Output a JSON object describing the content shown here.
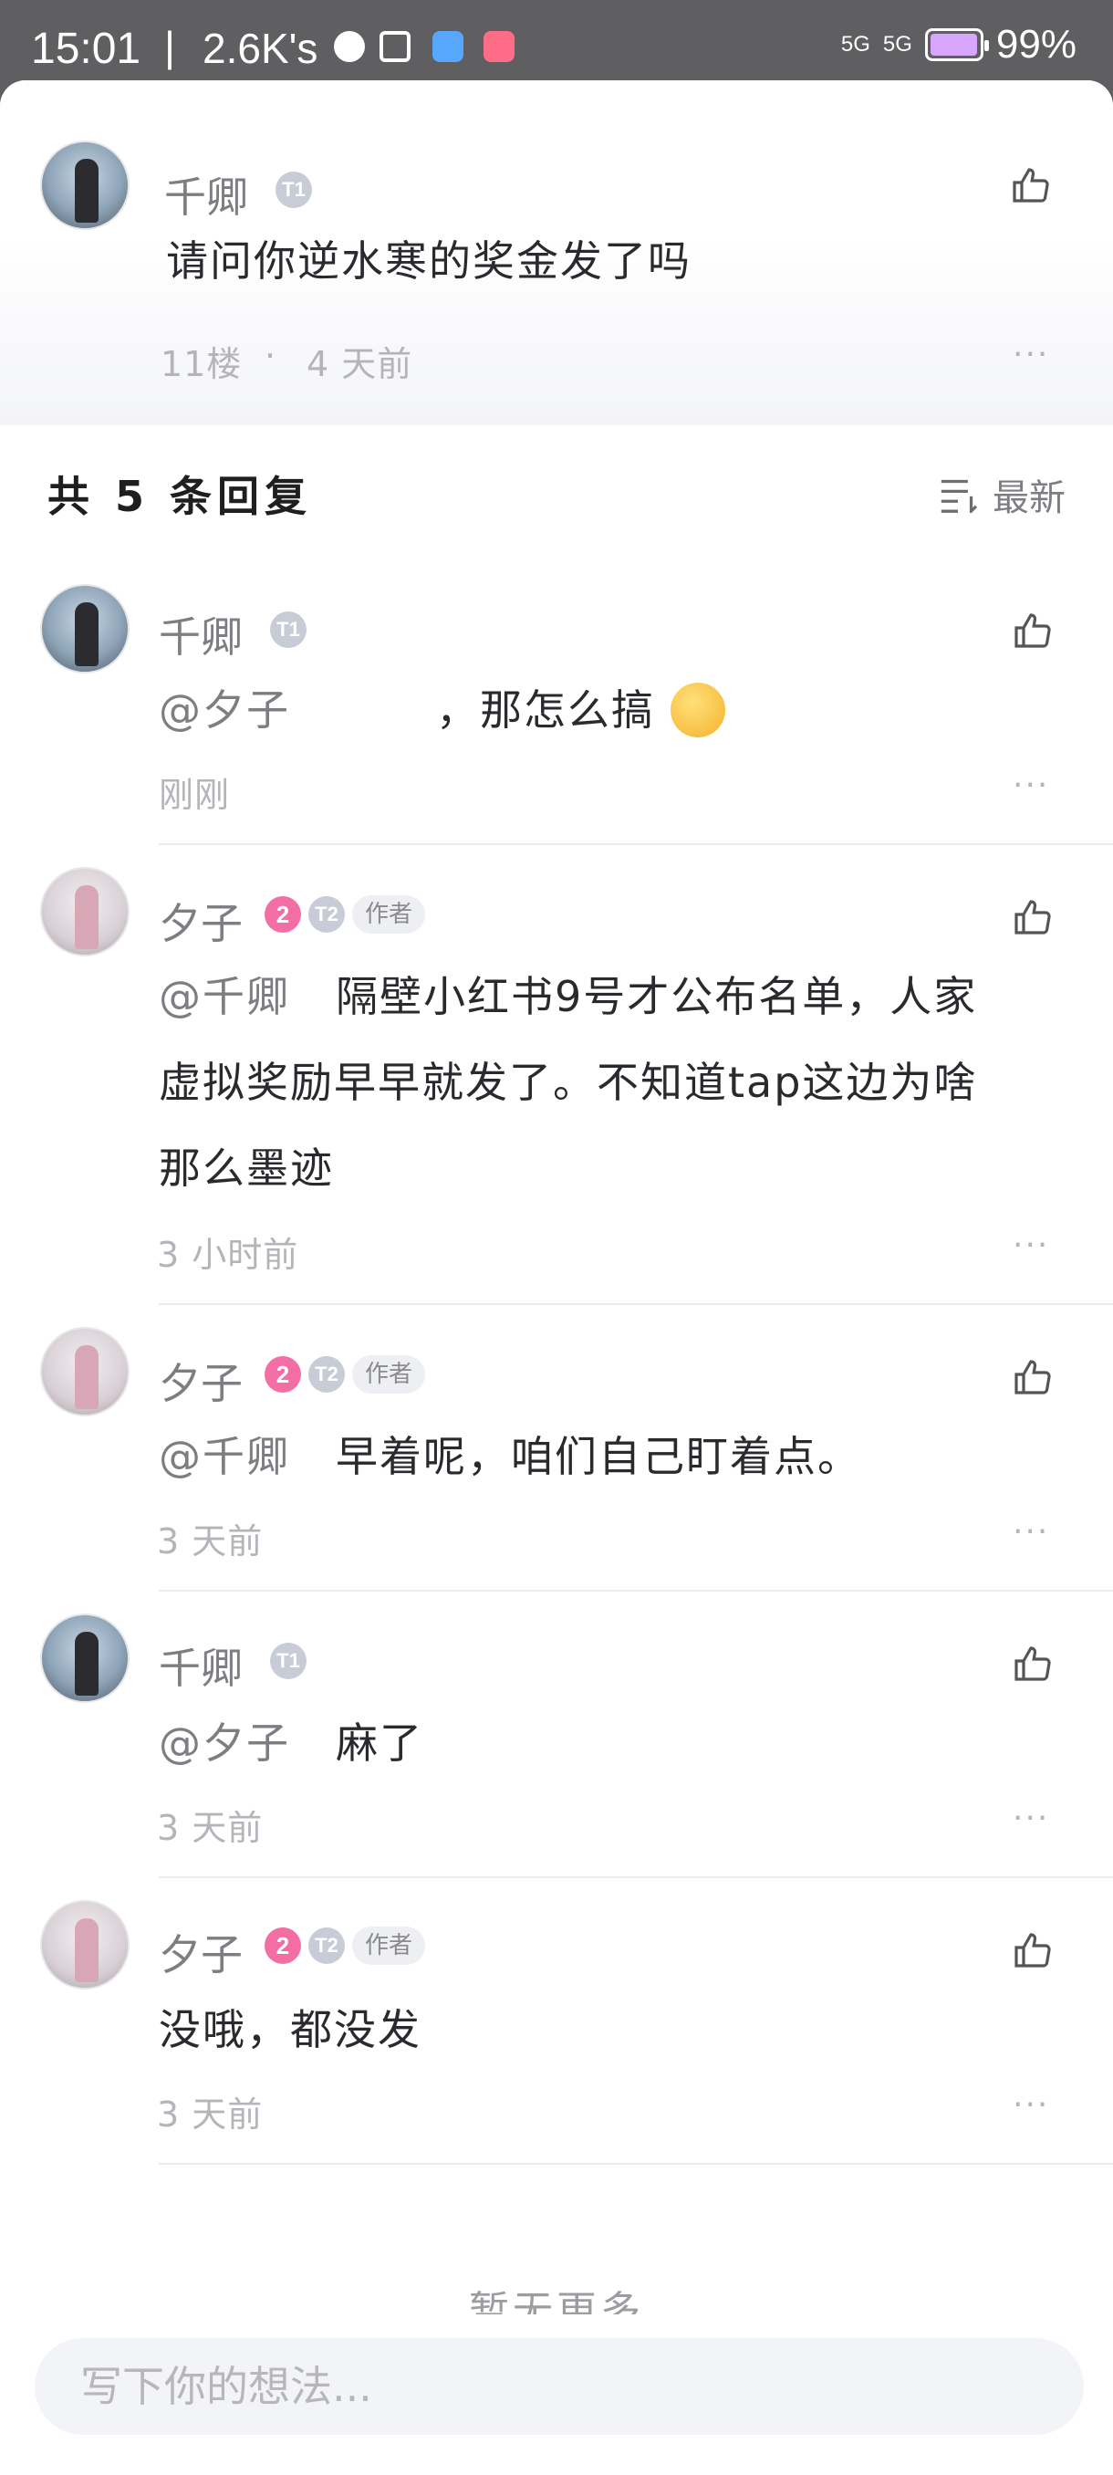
{
  "status_bar": {
    "time": "15:01",
    "separator": "|",
    "net_speed": "2.6K's",
    "signal1": "5G",
    "signal2": "5G",
    "battery": "99%",
    "battery_level": 0.99
  },
  "parent_comment": {
    "username": "千卿",
    "badge": "T1",
    "text": "请问你逆水寒的奖金发了吗",
    "floor": "11楼",
    "dot": "·",
    "time": "4 天前",
    "more": "···"
  },
  "replies_header": {
    "total_label": "共 5 条回复",
    "sort_label": "最新"
  },
  "replies": [
    {
      "username": "千卿",
      "badge": "T1",
      "mention": "@夕子",
      "text": "，那怎么搞",
      "time": "刚刚",
      "more": "···"
    },
    {
      "username": "夕子",
      "level": "2",
      "badge": "T2",
      "author_tag": "作者",
      "mention": "@千卿",
      "text_line1": "隔壁小红书9号才公布名单，人家",
      "text_line2": "虚拟奖励早早就发了。不知道tap这边为啥",
      "text_line3": "那么墨迹",
      "time": "3 小时前",
      "more": "···"
    },
    {
      "username": "夕子",
      "level": "2",
      "badge": "T2",
      "author_tag": "作者",
      "mention": "@千卿",
      "text": "早着呢，咱们自己盯着点。",
      "time": "3 天前",
      "more": "···"
    },
    {
      "username": "千卿",
      "badge": "T1",
      "mention": "@夕子",
      "text": "麻了",
      "time": "3 天前",
      "more": "···"
    },
    {
      "username": "夕子",
      "level": "2",
      "badge": "T2",
      "author_tag": "作者",
      "text": "没哦，都没发",
      "time": "3 天前",
      "more": "···"
    }
  ],
  "footer": {
    "no_more": "暂无更多",
    "input_placeholder": "写下你的想法..."
  },
  "icons": {
    "like": "thumbs-up-icon",
    "sort": "sort-list-icon",
    "more": "more-dots-icon"
  },
  "colors": {
    "text_primary": "#2a2a2e",
    "text_secondary": "#7d7d82",
    "meta": "#b4b4b9",
    "level_badge": "#f26ea4"
  }
}
